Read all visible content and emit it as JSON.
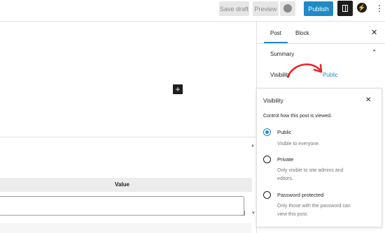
{
  "toolbar": {
    "save_draft_label": "Save draft",
    "preview_label": "Preview",
    "publish_label": "Publish",
    "bolt_icon": "⚡",
    "kebab_icon": "⋮"
  },
  "editor": {
    "add_block_icon": "+",
    "meta_table": {
      "columns": [
        "Value"
      ]
    },
    "collapse_icon": "▲",
    "scroll_icon": "▼"
  },
  "sidebar": {
    "tabs": [
      {
        "label": "Post",
        "active": true
      },
      {
        "label": "Block",
        "active": false
      }
    ],
    "close_icon": "✕",
    "summary_label": "Summary",
    "summary_chevron": "⌃",
    "visibility_label": "Visibility",
    "visibility_value": "Public"
  },
  "popover": {
    "title": "Visibility",
    "close_icon": "✕",
    "description": "Control how this post is viewed.",
    "options": [
      {
        "label": "Public",
        "help": "Visible to everyone.",
        "checked": true
      },
      {
        "label": "Private",
        "help_lines": [
          "Only visible to site admins and",
          "editors."
        ],
        "checked": false
      },
      {
        "label": "Password protected",
        "help_lines": [
          "Only those with the password can",
          "view this post."
        ],
        "checked": false
      }
    ]
  },
  "colors": {
    "accent": "#1f8ac6",
    "arrow": "#e3262b"
  }
}
